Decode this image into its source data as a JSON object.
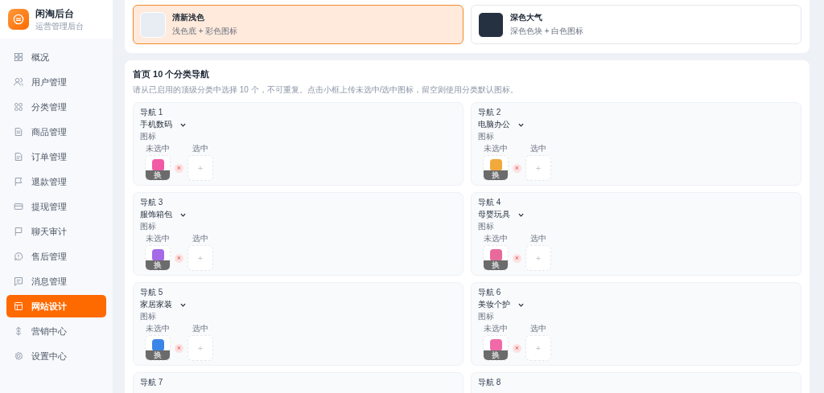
{
  "brand": {
    "title": "闲淘后台",
    "subtitle": "运营管理后台"
  },
  "sidebar": {
    "items": [
      {
        "label": "概况",
        "selected": false
      },
      {
        "label": "用户管理",
        "selected": false
      },
      {
        "label": "分类管理",
        "selected": false
      },
      {
        "label": "商品管理",
        "selected": false
      },
      {
        "label": "订单管理",
        "selected": false
      },
      {
        "label": "退款管理",
        "selected": false
      },
      {
        "label": "提现管理",
        "selected": false
      },
      {
        "label": "聊天审计",
        "selected": false
      },
      {
        "label": "售后管理",
        "selected": false
      },
      {
        "label": "消息管理",
        "selected": false
      },
      {
        "label": "网站设计",
        "selected": true
      },
      {
        "label": "营销中心",
        "selected": false
      },
      {
        "label": "设置中心",
        "selected": false
      }
    ]
  },
  "themes": [
    {
      "name": "清新浅色",
      "description": "浅色底 + 彩色图标",
      "color": "#e8edf4",
      "selected": true
    },
    {
      "name": "深色大气",
      "description": "深色色块 + 白色图标",
      "color": "#253041",
      "selected": false
    }
  ],
  "category_nav": {
    "title": "首页 10 个分类导航",
    "description": "请从已启用的顶级分类中选择 10 个，不可重复。点击小框上传未选中/选中图标，留空则使用分类默认图标。",
    "items": [
      {
        "title": "导航 1",
        "category": "手机数码",
        "icon_label": "图标",
        "unselected_label": "未选中",
        "selected_label": "选中",
        "replace_label": "换",
        "remove": "×",
        "upload": "+",
        "color": "#f25aa5"
      },
      {
        "title": "导航 2",
        "category": "电脑办公",
        "icon_label": "图标",
        "unselected_label": "未选中",
        "selected_label": "选中",
        "replace_label": "换",
        "remove": "×",
        "upload": "+",
        "color": "#f2a93b"
      },
      {
        "title": "导航 3",
        "category": "服饰箱包",
        "icon_label": "图标",
        "unselected_label": "未选中",
        "selected_label": "选中",
        "replace_label": "换",
        "remove": "×",
        "upload": "+",
        "color": "#a46ae8"
      },
      {
        "title": "导航 4",
        "category": "母婴玩具",
        "icon_label": "图标",
        "unselected_label": "未选中",
        "selected_label": "选中",
        "replace_label": "换",
        "remove": "×",
        "upload": "+",
        "color": "#e86a9a"
      },
      {
        "title": "导航 5",
        "category": "家居家装",
        "icon_label": "图标",
        "unselected_label": "未选中",
        "selected_label": "选中",
        "replace_label": "换",
        "remove": "×",
        "upload": "+",
        "color": "#3a86e8"
      },
      {
        "title": "导航 6",
        "category": "美妆个护",
        "icon_label": "图标",
        "unselected_label": "未选中",
        "selected_label": "选中",
        "replace_label": "换",
        "remove": "×",
        "upload": "+",
        "color": "#f06aa8"
      },
      {
        "title": "导航 7"
      },
      {
        "title": "导航 8"
      }
    ]
  }
}
